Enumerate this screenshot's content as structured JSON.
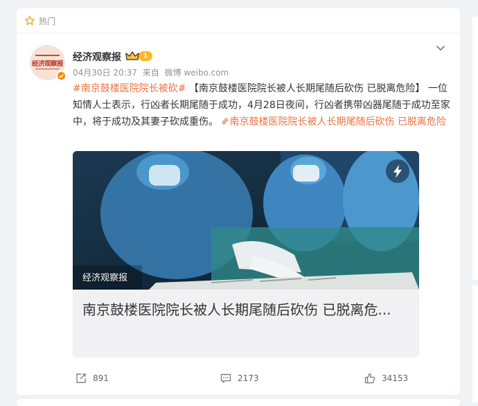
{
  "feed": {
    "hot_label": "热门"
  },
  "post": {
    "author": "经济观察报",
    "avatar_text": "经济观察报",
    "level": "1",
    "timestamp": "04月30日 20:37",
    "source_prefix": "来自",
    "source": "微博 weibo.com",
    "topic": "#南京鼓楼医院院长被砍#",
    "headline": "【南京鼓楼医院院长被人长期尾随后砍伤 已脱离危险】",
    "body": "一位知情人士表示，行凶者长期尾随于成功，4月28日夜间，行凶者携带凶器尾随于成功至家中，将于成功及其妻子砍成重伤。",
    "link_text": "南京鼓楼医院院长被人长期尾随后砍伤 已脱离危险",
    "media": {
      "source_tag": "经济观察报",
      "title": "南京鼓楼医院院长被人长期尾随后砍伤 已脱离危..."
    },
    "actions": {
      "reposts": "891",
      "comments": "2173",
      "likes": "34153"
    }
  },
  "colors": {
    "accent": "#eb7340",
    "verified": "#ff8200",
    "level_badge": "#ffb727"
  },
  "icons": [
    "star-icon",
    "crown-icon",
    "verified-icon",
    "chevron-down-icon",
    "link-icon",
    "bolt-icon",
    "repost-icon",
    "comment-icon",
    "like-icon"
  ]
}
